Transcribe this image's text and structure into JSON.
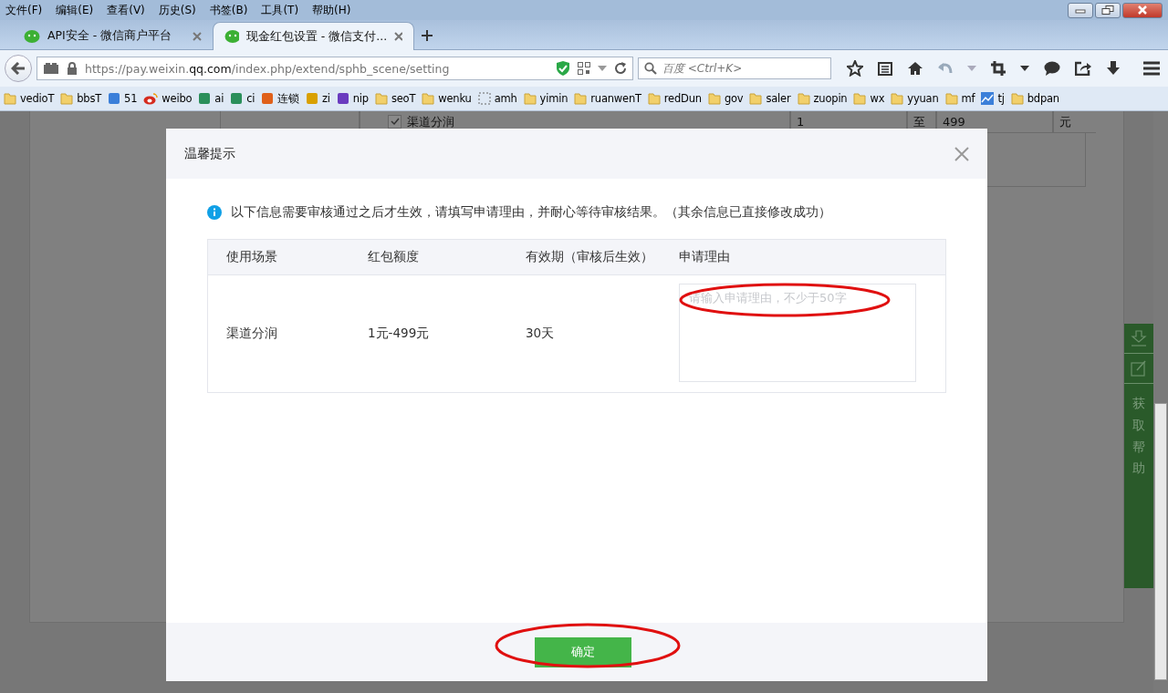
{
  "menu_bar": [
    "文件(F)",
    "编辑(E)",
    "查看(V)",
    "历史(S)",
    "书签(B)",
    "工具(T)",
    "帮助(H)"
  ],
  "tabs": [
    {
      "title": "API安全 - 微信商户平台",
      "selected": false
    },
    {
      "title": "现金红包设置 - 微信支付...",
      "selected": true
    }
  ],
  "address_bar": {
    "url": "https://pay.weixin.**qq.com**/index.php/extend/sphb_scene/setting"
  },
  "search": {
    "placeholder": "百度 <Ctrl+K>"
  },
  "bookmarks": [
    {
      "label": "vedioT",
      "kind": "folder"
    },
    {
      "label": "bbsT",
      "kind": "folder"
    },
    {
      "label": "51",
      "kind": "blue"
    },
    {
      "label": "weibo",
      "kind": "weibo"
    },
    {
      "label": "ai",
      "kind": "green"
    },
    {
      "label": "ci",
      "kind": "green"
    },
    {
      "label": "连锁",
      "kind": "orange"
    },
    {
      "label": "zi",
      "kind": "yellow"
    },
    {
      "label": "nip",
      "kind": "purple"
    },
    {
      "label": "seoT",
      "kind": "folder"
    },
    {
      "label": "wenku",
      "kind": "folder"
    },
    {
      "label": "amh",
      "kind": "dashed"
    },
    {
      "label": "yimin",
      "kind": "folder"
    },
    {
      "label": "ruanwenT",
      "kind": "folder"
    },
    {
      "label": "redDun",
      "kind": "folder"
    },
    {
      "label": "gov",
      "kind": "folder"
    },
    {
      "label": "saler",
      "kind": "folder"
    },
    {
      "label": "zuopin",
      "kind": "folder"
    },
    {
      "label": "wx",
      "kind": "folder"
    },
    {
      "label": "yyuan",
      "kind": "folder"
    },
    {
      "label": "mf",
      "kind": "folder"
    },
    {
      "label": "tj",
      "kind": "chart"
    },
    {
      "label": "bdpan",
      "kind": "folder"
    }
  ],
  "background_row": {
    "checked": true,
    "scene": "渠道分润",
    "min": "1",
    "separator": "至",
    "max": "499",
    "unit": "元"
  },
  "dialog": {
    "title": "温馨提示",
    "notice": "以下信息需要审核通过之后才生效，请填写申请理由，并耐心等待审核结果。（其余信息已直接修改成功）",
    "columns": [
      "使用场景",
      "红包额度",
      "有效期（审核后生效）",
      "申请理由"
    ],
    "rows": [
      {
        "scene": "渠道分润",
        "amount": "1元-499元",
        "validity": "30天",
        "reason": {
          "placeholder": "请输入申请理由，不少于50字"
        }
      }
    ],
    "confirm_button": "确定"
  },
  "help_widget": {
    "label": "获取帮助"
  }
}
